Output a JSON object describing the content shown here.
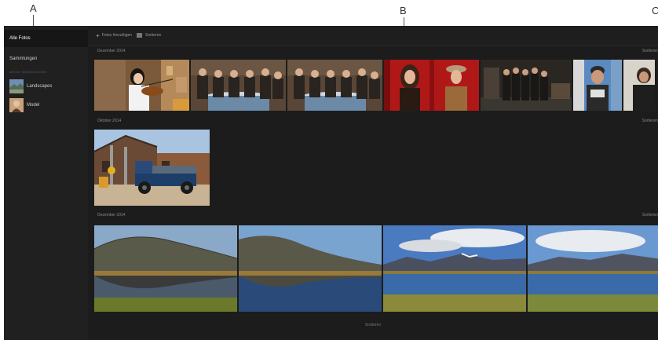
{
  "callouts": [
    "A",
    "B",
    "C"
  ],
  "sidebar": {
    "active": "Alle Fotos",
    "item2": "Sammlungen",
    "section": "MEINE SAMMLUNGEN",
    "albums": [
      {
        "label": "Landscapes",
        "icon": "landscape-thumb"
      },
      {
        "label": "Model",
        "icon": "portrait-thumb"
      }
    ]
  },
  "toolbar": {
    "add_label": "Fotos hinzufügen",
    "sort_label": "Sortieren"
  },
  "sections": [
    {
      "label": "Dezember 2014",
      "right": "Sortieren"
    },
    {
      "label": "Oktober 2014",
      "right": "Sortieren"
    },
    {
      "label": "Dezember 2014",
      "right": "Sortieren"
    }
  ],
  "footer": "Sortieren",
  "colors": {
    "app_bg": "#1a1a1a",
    "sidebar_bg": "#202020",
    "text": "#cfcfcf"
  }
}
